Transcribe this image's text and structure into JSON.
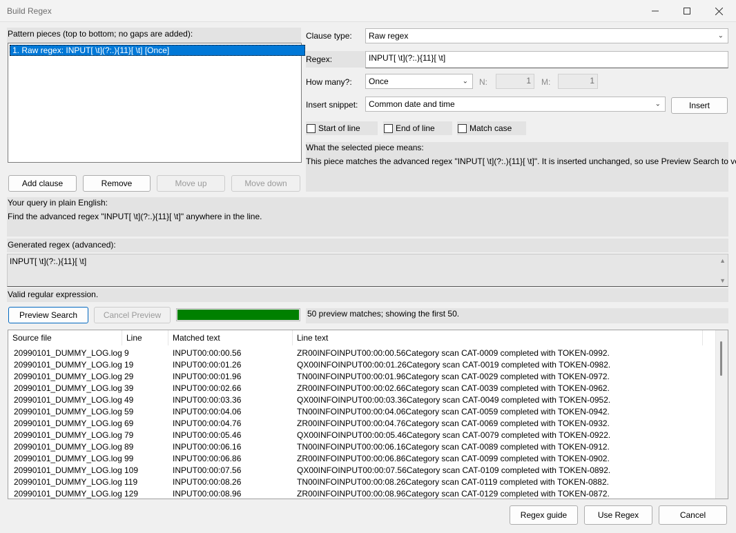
{
  "window": {
    "title": "Build Regex"
  },
  "pattern": {
    "label": "Pattern pieces (top to bottom; no gaps are added):",
    "items": [
      "1. Raw regex: INPUT[ \\t](?:.){11}[ \\t]  [Once]"
    ]
  },
  "buttons": {
    "add_clause": "Add clause",
    "remove": "Remove",
    "move_up": "Move up",
    "move_down": "Move down",
    "insert": "Insert",
    "preview": "Preview Search",
    "cancel_preview": "Cancel Preview",
    "regex_guide": "Regex guide",
    "use_regex": "Use Regex",
    "cancel": "Cancel"
  },
  "clause": {
    "type_label": "Clause type:",
    "type_value": "Raw regex",
    "regex_label": "Regex:",
    "regex_value": "INPUT[ \\t](?:.){11}[ \\t]",
    "howmany_label": "How many?:",
    "howmany_value": "Once",
    "n_label": "N:",
    "n_value": "1",
    "m_label": "M:",
    "m_value": "1",
    "snippet_label": "Insert snippet:",
    "snippet_value": "Common date and time"
  },
  "checks": {
    "start_of_line": "Start of line",
    "end_of_line": "End of line",
    "match_case": "Match case"
  },
  "meaning": {
    "title": "What the selected piece means:",
    "text": "This piece matches the advanced regex \"INPUT[ \\t](?:.){11}[ \\t]\". It is inserted unchanged, so use Preview Search to verify it."
  },
  "plain": {
    "title": "Your query in plain English:",
    "text": "Find the advanced regex \"INPUT[ \\t](?:.){11}[ \\t]\" anywhere in the line."
  },
  "generated": {
    "title": "Generated regex (advanced):",
    "value": "INPUT[ \\t](?:.){11}[ \\t]"
  },
  "status": "Valid regular expression.",
  "preview_status": "50 preview matches; showing the first 50.",
  "progress": 1.0,
  "results": {
    "columns": [
      "Source file",
      "Line",
      "Matched text",
      "Line text"
    ],
    "rows": [
      [
        "20990101_DUMMY_LOG.log",
        "9",
        "INPUT00:00:00.56",
        "ZR00INFOINPUT00:00:00.56Category scan CAT-0009 completed with TOKEN-0992."
      ],
      [
        "20990101_DUMMY_LOG.log",
        "19",
        "INPUT00:00:01.26",
        "QX00INFOINPUT00:00:01.26Category scan CAT-0019 completed with TOKEN-0982."
      ],
      [
        "20990101_DUMMY_LOG.log",
        "29",
        "INPUT00:00:01.96",
        "TN00INFOINPUT00:00:01.96Category scan CAT-0029 completed with TOKEN-0972."
      ],
      [
        "20990101_DUMMY_LOG.log",
        "39",
        "INPUT00:00:02.66",
        "ZR00INFOINPUT00:00:02.66Category scan CAT-0039 completed with TOKEN-0962."
      ],
      [
        "20990101_DUMMY_LOG.log",
        "49",
        "INPUT00:00:03.36",
        "QX00INFOINPUT00:00:03.36Category scan CAT-0049 completed with TOKEN-0952."
      ],
      [
        "20990101_DUMMY_LOG.log",
        "59",
        "INPUT00:00:04.06",
        "TN00INFOINPUT00:00:04.06Category scan CAT-0059 completed with TOKEN-0942."
      ],
      [
        "20990101_DUMMY_LOG.log",
        "69",
        "INPUT00:00:04.76",
        "ZR00INFOINPUT00:00:04.76Category scan CAT-0069 completed with TOKEN-0932."
      ],
      [
        "20990101_DUMMY_LOG.log",
        "79",
        "INPUT00:00:05.46",
        "QX00INFOINPUT00:00:05.46Category scan CAT-0079 completed with TOKEN-0922."
      ],
      [
        "20990101_DUMMY_LOG.log",
        "89",
        "INPUT00:00:06.16",
        "TN00INFOINPUT00:00:06.16Category scan CAT-0089 completed with TOKEN-0912."
      ],
      [
        "20990101_DUMMY_LOG.log",
        "99",
        "INPUT00:00:06.86",
        "ZR00INFOINPUT00:00:06.86Category scan CAT-0099 completed with TOKEN-0902."
      ],
      [
        "20990101_DUMMY_LOG.log",
        "109",
        "INPUT00:00:07.56",
        "QX00INFOINPUT00:00:07.56Category scan CAT-0109 completed with TOKEN-0892."
      ],
      [
        "20990101_DUMMY_LOG.log",
        "119",
        "INPUT00:00:08.26",
        "TN00INFOINPUT00:00:08.26Category scan CAT-0119 completed with TOKEN-0882."
      ],
      [
        "20990101_DUMMY_LOG.log",
        "129",
        "INPUT00:00:08.96",
        "ZR00INFOINPUT00:00:08.96Category scan CAT-0129 completed with TOKEN-0872."
      ]
    ]
  },
  "colors": {
    "accent": "#0078d7",
    "progress": "#008000",
    "panel": "#e3e3e3"
  }
}
